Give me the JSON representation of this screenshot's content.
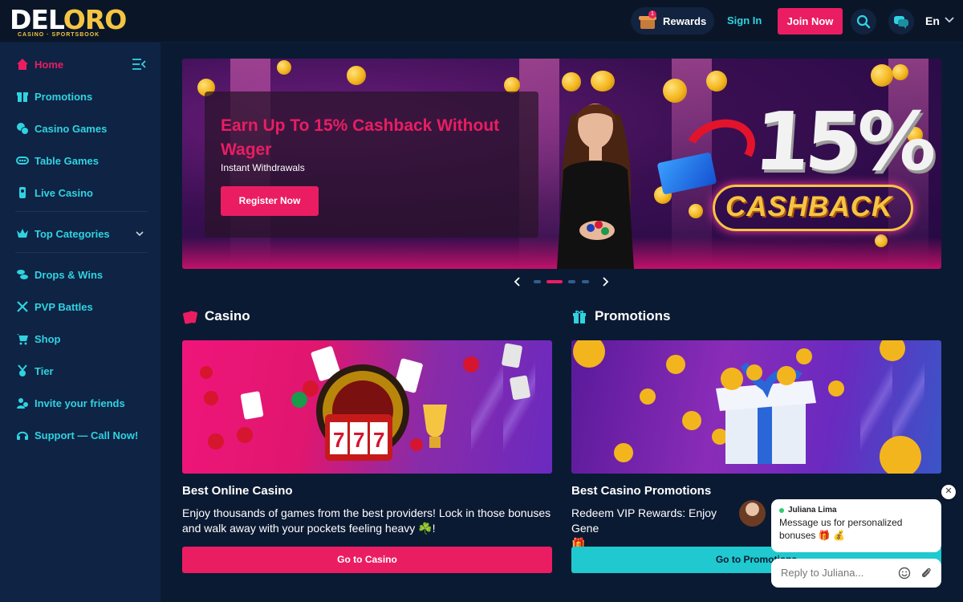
{
  "brand": {
    "logo_main_a": "DEL",
    "logo_main_b": "ORO",
    "logo_sub": "CASINO · SPORTSBOOK",
    "accent": "#ea1d63",
    "cyan": "#2fd3e0"
  },
  "header": {
    "rewards_label": "Rewards",
    "rewards_badge": "1",
    "signin_label": "Sign In",
    "join_label": "Join Now",
    "language": "En"
  },
  "sidebar": {
    "items": [
      {
        "label": "Home",
        "icon": "home-icon"
      },
      {
        "label": "Promotions",
        "icon": "gift-icon"
      },
      {
        "label": "Casino Games",
        "icon": "chips-icon"
      },
      {
        "label": "Table Games",
        "icon": "table-icon"
      },
      {
        "label": "Live Casino",
        "icon": "live-icon"
      },
      {
        "label": "Top Categories",
        "icon": "crown-icon"
      },
      {
        "label": "Drops & Wins",
        "icon": "coins-icon"
      },
      {
        "label": "PVP Battles",
        "icon": "swords-icon"
      },
      {
        "label": "Shop",
        "icon": "cart-icon"
      },
      {
        "label": "Tier",
        "icon": "medal-icon"
      },
      {
        "label": "Invite your friends",
        "icon": "users-icon"
      },
      {
        "label": "Support — Call Now!",
        "icon": "headset-icon"
      }
    ]
  },
  "hero": {
    "title": "Earn Up To 15% Cashback Without Wager",
    "subtitle": "Instant Withdrawals",
    "button": "Register Now",
    "big_text": "15%",
    "cashback_text": "CASHBACK",
    "slides": 4,
    "active_slide": 2
  },
  "sections": {
    "casino": {
      "title": "Casino",
      "card_title": "Best Online Casino",
      "card_desc": "Enjoy thousands of games from the best providers! Lock in those bonuses and walk away with your pockets feeling heavy ☘️!",
      "button": "Go to Casino"
    },
    "promotions": {
      "title": "Promotions",
      "card_title": "Best Casino Promotions",
      "card_desc": "Redeem VIP Rewards: Enjoy Gene",
      "card_desc_line2": "🎁",
      "button": "Go to Promotions"
    }
  },
  "chat": {
    "agent_name": "Juliana Lima",
    "message": "Message us for personalized bonuses 🎁 💰",
    "input_placeholder": "Reply to Juliana...",
    "close": "✕"
  }
}
